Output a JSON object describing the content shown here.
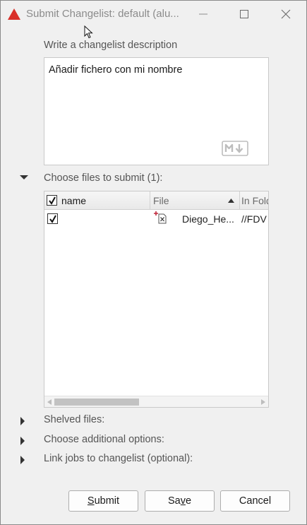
{
  "window": {
    "title": "Submit Changelist: default (alu..."
  },
  "description": {
    "label": "Write a changelist description",
    "value": "Añadir fichero con mi nombre",
    "markdown_icon": "markdown-icon"
  },
  "files_section": {
    "label": "Choose files to submit (1):",
    "expanded": true,
    "columns": [
      "name",
      "File",
      "In Fold"
    ],
    "sorted_column": "File",
    "rows": [
      {
        "checked": true,
        "file": "Diego_He...",
        "folder": "//FDV"
      }
    ]
  },
  "sections": {
    "shelved": "Shelved files:",
    "options": "Choose additional options:",
    "jobs": "Link jobs to changelist (optional):"
  },
  "buttons": {
    "submit_first": "S",
    "submit_rest": "ubmit",
    "save_first": "Sa",
    "save_mid": "v",
    "save_rest": "e",
    "cancel": "Cancel"
  },
  "colors": {
    "app_icon": "#d9302a",
    "add_marker": "#c0283c"
  }
}
